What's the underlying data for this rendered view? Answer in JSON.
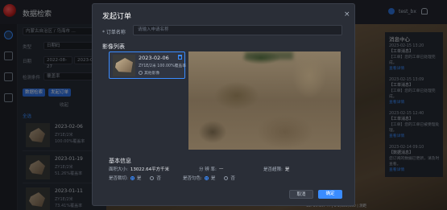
{
  "app": {
    "title": "数据检索",
    "user": "test_bx"
  },
  "panel": {
    "region_value": "内蒙古自治区 / 乌海市 ...",
    "type_label": "类型",
    "type_value": "日期码",
    "date_label": "日期",
    "date_from": "2022-08-27",
    "date_to": "2023-0...",
    "cloud_label": "检测条件",
    "cloud_value": "覆盖率",
    "btn_search": "数据检索",
    "btn_order": "发起订单",
    "collapse": "收起",
    "select_all": "全选",
    "results": [
      {
        "date": "2023-02-06",
        "sub1": "ZY1E/2米",
        "sub2": "100.00%覆盖率"
      },
      {
        "date": "2023-01-19",
        "sub1": "ZY1E/2米",
        "sub2": "51.26%覆盖率"
      },
      {
        "date": "2023-01-11",
        "sub1": "ZY1E/2米",
        "sub2": "73.41%覆盖率"
      }
    ]
  },
  "map": {
    "status": "18: 39.197 ... | 1:1,000,000 | 测距"
  },
  "messages": {
    "title": "消息中心",
    "items": [
      {
        "time": "2023-02-15 13:20",
        "title": "【工单消息】",
        "body": "【工单】您的工单已处理完成。",
        "link": "查看详情"
      },
      {
        "time": "2023-02-15 13:09",
        "title": "【工单消息】",
        "body": "【工单】您的工单已处理完成。",
        "link": "查看详情"
      },
      {
        "time": "2023-02-15 12:40",
        "title": "【工单消息】",
        "body": "【工单】您的工单已被受理处理。",
        "link": "查看详情"
      },
      {
        "time": "2023-02-14 09:10",
        "title": "【数据消息】",
        "body": "您订阅的数据已更新，请及时查看。",
        "link": "查看详情"
      }
    ]
  },
  "modal": {
    "title": "发起订单",
    "close": "×",
    "name_label": "* 订单名称",
    "name_placeholder": "请输入申请名称",
    "images_title": "影像列表",
    "card": {
      "date": "2023-02-06",
      "sub": "ZY1E/2米  100.00%覆盖率",
      "radio": "其他影像"
    },
    "info_title": "基本信息",
    "area_label": "面积大小:",
    "area_value": "13022.64平方千米",
    "resolution_label": "分 辨 率:",
    "resolution_value": "—",
    "cover_label": "是否超限:",
    "cover_value": "是",
    "clip_label": "是否裁切:",
    "clip_yes": "是",
    "clip_no": "否",
    "merge_label": "是否匀色:",
    "merge_yes": "是",
    "merge_no": "否",
    "cancel": "取消",
    "confirm": "确定"
  }
}
